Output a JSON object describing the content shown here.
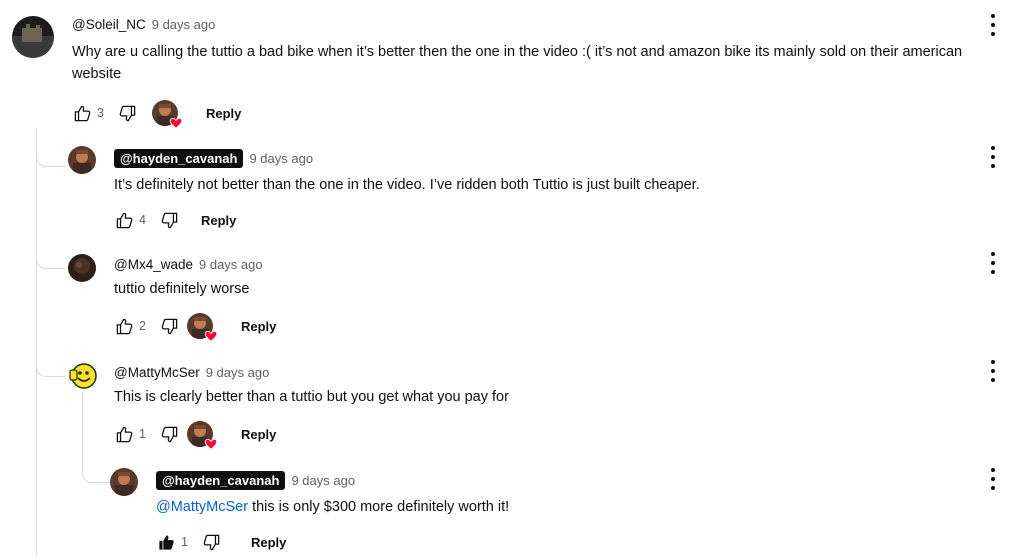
{
  "comments": [
    {
      "author": "@Soleil_NC",
      "time": "9 days ago",
      "text": "Why are u calling the tuttio a bad bike when it’s  better then the one in the video :( it’s  not and amazon bike its mainly sold on their american website",
      "likes": "3",
      "reply_label": "Reply"
    },
    {
      "author": "@hayden_cavanah",
      "time": "9 days ago",
      "text": "It’s definitely not better than the one in the video. I’ve ridden both Tuttio is just built cheaper.",
      "likes": "4",
      "reply_label": "Reply"
    },
    {
      "author": "@Mx4_wade",
      "time": "9 days ago",
      "text": "tuttio definitely worse",
      "likes": "2",
      "reply_label": "Reply"
    },
    {
      "author": "@MattyMcSer",
      "time": "9 days ago",
      "text": "This is clearly better than a tuttio but you get what you pay for",
      "likes": "1",
      "reply_label": "Reply"
    },
    {
      "author": "@hayden_cavanah",
      "time": "9 days ago",
      "mention": "@MattyMcSer",
      "text": " this is only $300 more definitely worth it!",
      "likes": "1",
      "reply_label": "Reply"
    }
  ],
  "colors": {
    "mention": "#065fd4",
    "heart": "#ff0033",
    "secondary_text": "#606060",
    "author_chip_bg": "#0f0f0f"
  },
  "icons": {
    "like": "thumb-up-outline-icon",
    "like_active": "thumb-up-filled-icon",
    "dislike": "thumb-down-outline-icon",
    "more": "more-vert-icon",
    "heart": "heart-icon"
  }
}
